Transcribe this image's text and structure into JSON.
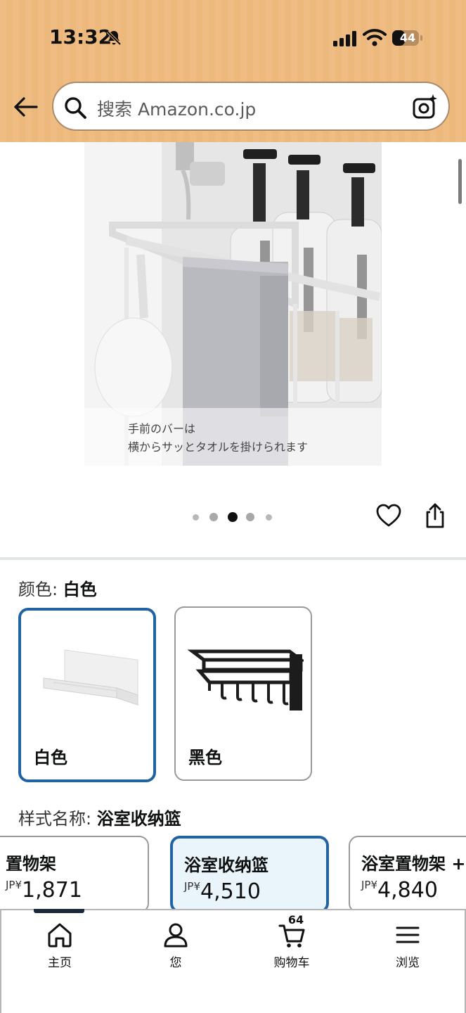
{
  "status_bar": {
    "time": "13:32",
    "battery": "44"
  },
  "search": {
    "placeholder": "搜索 Amazon.co.jp"
  },
  "product_image": {
    "caption_line1": "手前のバーは",
    "caption_line2": "横からサッとタオルを掛けられます",
    "carousel_total": 5,
    "carousel_active": 3
  },
  "color": {
    "label": "颜色:",
    "selected": "白色",
    "options": [
      {
        "name": "白色",
        "selected": true
      },
      {
        "name": "黑色",
        "selected": false
      }
    ]
  },
  "style": {
    "label": "样式名称:",
    "selected": "浴室收纳篮",
    "options": [
      {
        "name": "置物架",
        "currency": "JP¥",
        "price": "1,871",
        "selected": false
      },
      {
        "name": "浴室收纳篮",
        "currency": "JP¥",
        "price": "4,510",
        "selected": true
      },
      {
        "name": "浴室置物架 +",
        "currency": "JP¥",
        "price": "4,840",
        "selected": false
      }
    ]
  },
  "bottom_nav": {
    "items": [
      {
        "label": "主页",
        "icon": "home-icon"
      },
      {
        "label": "您",
        "icon": "person-icon"
      },
      {
        "label": "购物车",
        "icon": "cart-icon",
        "count": "64"
      },
      {
        "label": "浏览",
        "icon": "menu-icon"
      }
    ]
  },
  "colors": {
    "header_bg": "#efbd84",
    "selected_border": "#2162a1",
    "selected_bg": "#e9f4fb"
  }
}
